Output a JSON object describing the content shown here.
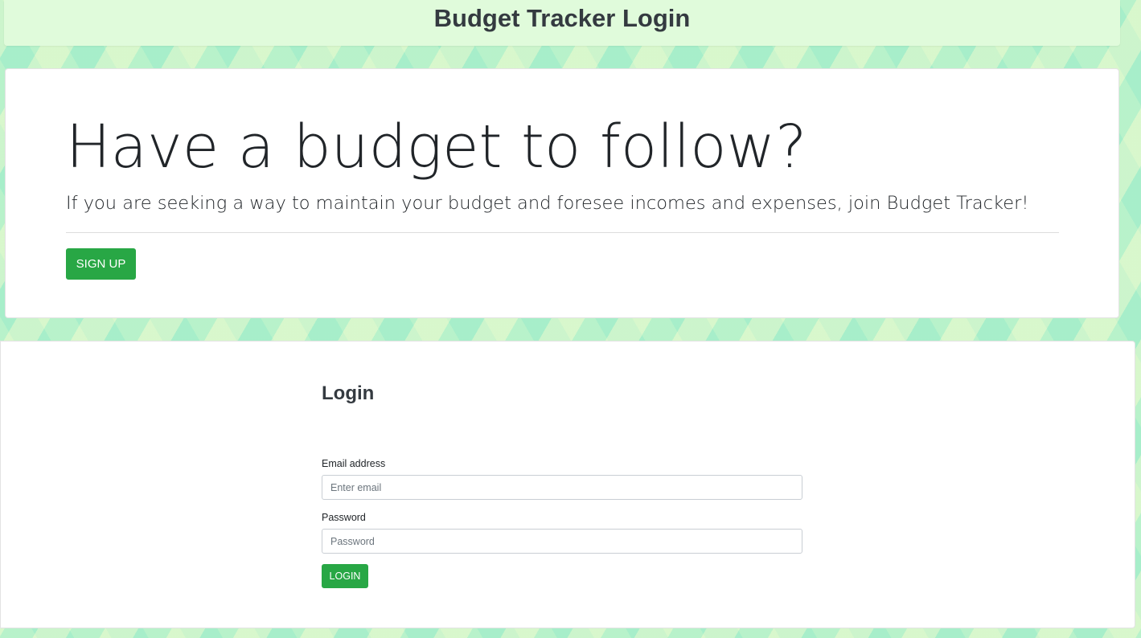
{
  "header": {
    "title": "Budget Tracker Login"
  },
  "hero": {
    "heading": "Have a budget to follow?",
    "lead": "If you are seeking a way to maintain your budget and foresee incomes and expenses, join Budget Tracker!",
    "signup_label": "SIGN UP"
  },
  "login": {
    "heading": "Login",
    "email_label": "Email address",
    "email_placeholder": "Enter email",
    "email_value": "",
    "password_label": "Password",
    "password_placeholder": "Password",
    "password_value": "",
    "submit_label": "LOGIN"
  },
  "colors": {
    "accent": "#28a745",
    "header_background": "#e0fbdb",
    "page_background": "#b6f2cf"
  }
}
